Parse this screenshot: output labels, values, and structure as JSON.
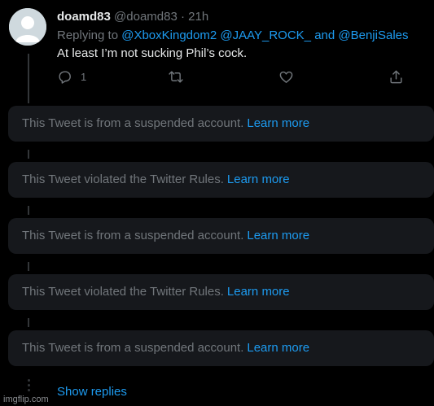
{
  "tweet": {
    "display_name": "doamd83",
    "handle": "@doamd83",
    "separator": "·",
    "time": "21h",
    "replying_prefix": "Replying to",
    "mentions": [
      "@XboxKingdom2",
      "@JAAY_ROCK_"
    ],
    "mention_joiner": "and",
    "last_mention": "@BenjiSales",
    "text": "At least I’m not sucking Phil’s cock.",
    "reply_count": "1",
    "actions": {
      "reply_icon": "reply-icon",
      "retweet_icon": "retweet-icon",
      "like_icon": "heart-icon",
      "share_icon": "share-icon"
    }
  },
  "notices": [
    {
      "text": "This Tweet is from a suspended account.",
      "link": "Learn more"
    },
    {
      "text": "This Tweet violated the Twitter Rules.",
      "link": "Learn more"
    },
    {
      "text": "This Tweet is from a suspended account.",
      "link": "Learn more"
    },
    {
      "text": "This Tweet violated the Twitter Rules.",
      "link": "Learn more"
    },
    {
      "text": "This Tweet is from a suspended account.",
      "link": "Learn more"
    }
  ],
  "show_replies": "Show replies",
  "watermark": "imgflip.com",
  "colors": {
    "background": "#000000",
    "card": "#16181c",
    "primary_text": "#e7e9ea",
    "secondary_text": "#71767b",
    "link": "#1d9bf0"
  }
}
